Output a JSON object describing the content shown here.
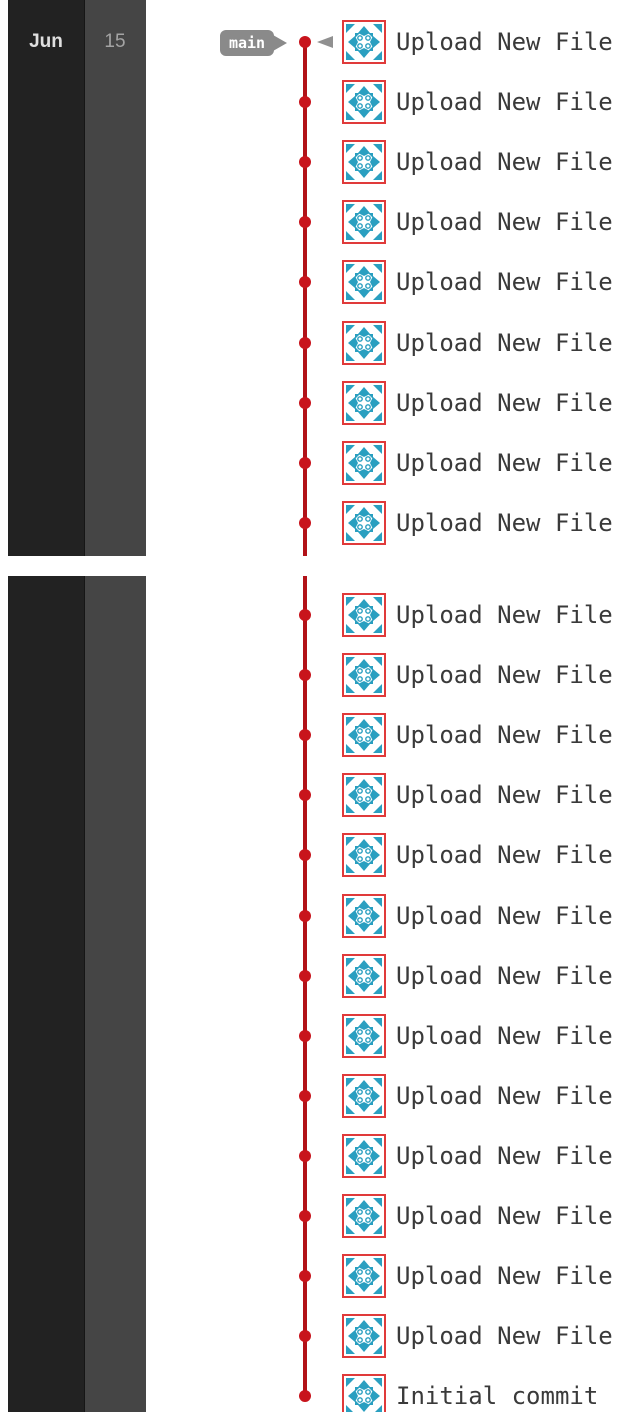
{
  "date": {
    "month": "Jun",
    "day": "15"
  },
  "branch": {
    "name": "main"
  },
  "colors": {
    "graph_line": "#b21218",
    "node": "#c8141c",
    "avatar_border": "#e03a3a",
    "avatar_pattern": "#2a9fc0",
    "date_month_bg": "#222222",
    "date_day_bg": "#454545",
    "branch_tag_bg": "#8a8a8a"
  },
  "icons": {
    "avatar": "identicon-avatar-icon",
    "branch_pointer": "triangle-left-icon"
  },
  "panel_1": {
    "commits": [
      {
        "message": "Upload New File",
        "author_icon": "identicon-avatar-icon"
      },
      {
        "message": "Upload New File",
        "author_icon": "identicon-avatar-icon"
      },
      {
        "message": "Upload New File",
        "author_icon": "identicon-avatar-icon"
      },
      {
        "message": "Upload New File",
        "author_icon": "identicon-avatar-icon"
      },
      {
        "message": "Upload New File",
        "author_icon": "identicon-avatar-icon"
      },
      {
        "message": "Upload New File",
        "author_icon": "identicon-avatar-icon"
      },
      {
        "message": "Upload New File",
        "author_icon": "identicon-avatar-icon"
      },
      {
        "message": "Upload New File",
        "author_icon": "identicon-avatar-icon"
      },
      {
        "message": "Upload New File",
        "author_icon": "identicon-avatar-icon"
      }
    ]
  },
  "panel_2": {
    "commits": [
      {
        "message": "Upload New File",
        "author_icon": "identicon-avatar-icon"
      },
      {
        "message": "Upload New File",
        "author_icon": "identicon-avatar-icon"
      },
      {
        "message": "Upload New File",
        "author_icon": "identicon-avatar-icon"
      },
      {
        "message": "Upload New File",
        "author_icon": "identicon-avatar-icon"
      },
      {
        "message": "Upload New File",
        "author_icon": "identicon-avatar-icon"
      },
      {
        "message": "Upload New File",
        "author_icon": "identicon-avatar-icon"
      },
      {
        "message": "Upload New File",
        "author_icon": "identicon-avatar-icon"
      },
      {
        "message": "Upload New File",
        "author_icon": "identicon-avatar-icon"
      },
      {
        "message": "Upload New File",
        "author_icon": "identicon-avatar-icon"
      },
      {
        "message": "Upload New File",
        "author_icon": "identicon-avatar-icon"
      },
      {
        "message": "Upload New File",
        "author_icon": "identicon-avatar-icon"
      },
      {
        "message": "Upload New File",
        "author_icon": "identicon-avatar-icon"
      },
      {
        "message": "Upload New File",
        "author_icon": "identicon-avatar-icon"
      },
      {
        "message": "Initial commit",
        "author_icon": "identicon-avatar-icon"
      }
    ]
  }
}
